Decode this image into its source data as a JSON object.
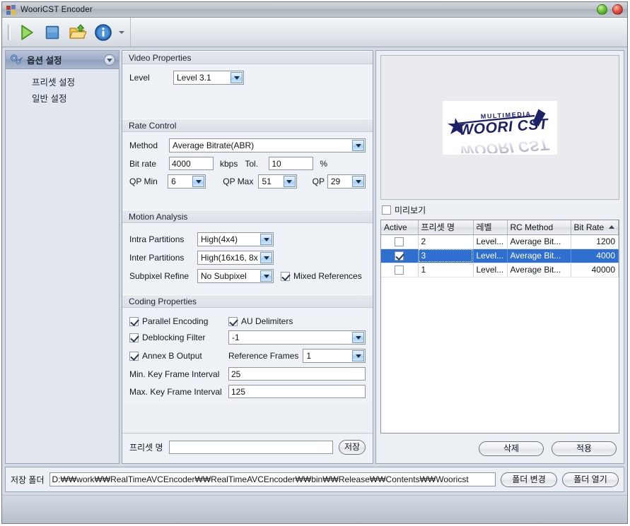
{
  "window": {
    "title": "WooriCST Encoder",
    "icon": "app-tiles-icon",
    "buttons": [
      {
        "name": "minimize",
        "color": "#6cc43a"
      },
      {
        "name": "close",
        "color": "#e3564a"
      }
    ]
  },
  "toolbar": {
    "items": [
      {
        "name": "start-encoding-button",
        "icon": "play-icon"
      },
      {
        "name": "stop-encoding-button",
        "icon": "stop-icon"
      },
      {
        "name": "open-folder-button",
        "icon": "folder-open-icon"
      },
      {
        "name": "about-button",
        "icon": "info-icon"
      },
      {
        "name": "toolbar-overflow-button",
        "icon": "chevron-down-icon"
      }
    ]
  },
  "sidebar": {
    "header": "옵션 설정",
    "items": [
      {
        "label": "프리셋 설정"
      },
      {
        "label": "일반 설정"
      }
    ]
  },
  "video_properties": {
    "title": "Video Properties",
    "level_label": "Level",
    "level_value": "Level 3.1"
  },
  "rate_control": {
    "title": "Rate Control",
    "method_label": "Method",
    "method_value": "Average Bitrate(ABR)",
    "bitrate_label": "Bit rate",
    "bitrate_value": "4000",
    "bitrate_unit": "kbps",
    "tol_label": "Tol.",
    "tol_value": "10",
    "tol_unit": "%",
    "qpmin_label": "QP Min",
    "qpmin_value": "6",
    "qpmax_label": "QP Max",
    "qpmax_value": "51",
    "qp_label": "QP",
    "qp_value": "29"
  },
  "motion_analysis": {
    "title": "Motion Analysis",
    "intra_label": "Intra Partitions",
    "intra_value": "High(4x4)",
    "inter_label": "Inter Partitions",
    "inter_value": "High(16x16, 8x",
    "subpixel_label": "Subpixel Refine",
    "subpixel_value": "No Subpixel",
    "mixed_refs_label": "Mixed References",
    "mixed_refs_checked": true
  },
  "coding_properties": {
    "title": "Coding Properties",
    "parallel_label": "Parallel Encoding",
    "parallel_checked": true,
    "au_label": "AU Delimiters",
    "au_checked": true,
    "deblock_label": "Deblocking Filter",
    "deblock_checked": true,
    "deblock_value": "-1",
    "annexb_label": "Annex B Output",
    "annexb_checked": true,
    "refframes_label": "Reference Frames",
    "refframes_value": "1",
    "minkey_label": "Min. Key Frame Interval",
    "minkey_value": "25",
    "maxkey_label": "Max. Key Frame Interval",
    "maxkey_value": "125"
  },
  "preset_save": {
    "label": "프리셋 명",
    "value": "",
    "placeholder": "",
    "save_button": "저장"
  },
  "preview": {
    "logo_primary": "WOORI CST",
    "logo_secondary": "MULTIMEDIA",
    "logo_color": "#1d2268",
    "checkbox_label": "미리보기",
    "checkbox_checked": false
  },
  "preset_table": {
    "columns": [
      "Active",
      "프리셋 명",
      "레벨",
      "RC Method",
      "Bit Rate"
    ],
    "sort_column": "Bit Rate",
    "sort_direction": "asc",
    "rows": [
      {
        "active": false,
        "name": "2",
        "level": "Level...",
        "rc": "Average Bit...",
        "bitrate": "1200",
        "selected": false
      },
      {
        "active": true,
        "name": "3",
        "level": "Level...",
        "rc": "Average Bit...",
        "bitrate": "4000",
        "selected": true
      },
      {
        "active": false,
        "name": "1",
        "level": "Level...",
        "rc": "Average Bit...",
        "bitrate": "40000",
        "selected": false
      }
    ],
    "delete_button": "삭제",
    "apply_button": "적용"
  },
  "footer": {
    "folder_label": "저장 폴더",
    "folder_path": "D:₩₩work₩₩RealTimeAVCEncoder₩₩RealTimeAVCEncoder₩₩bin₩₩Release₩₩Contents₩₩Wooricst",
    "change_folder_button": "폴더 변경",
    "open_folder_button": "폴더 열기"
  },
  "colors": {
    "selection": "#2f6fd0",
    "window_bg": "#d6dce6",
    "panel_bg": "#eef1f5"
  }
}
